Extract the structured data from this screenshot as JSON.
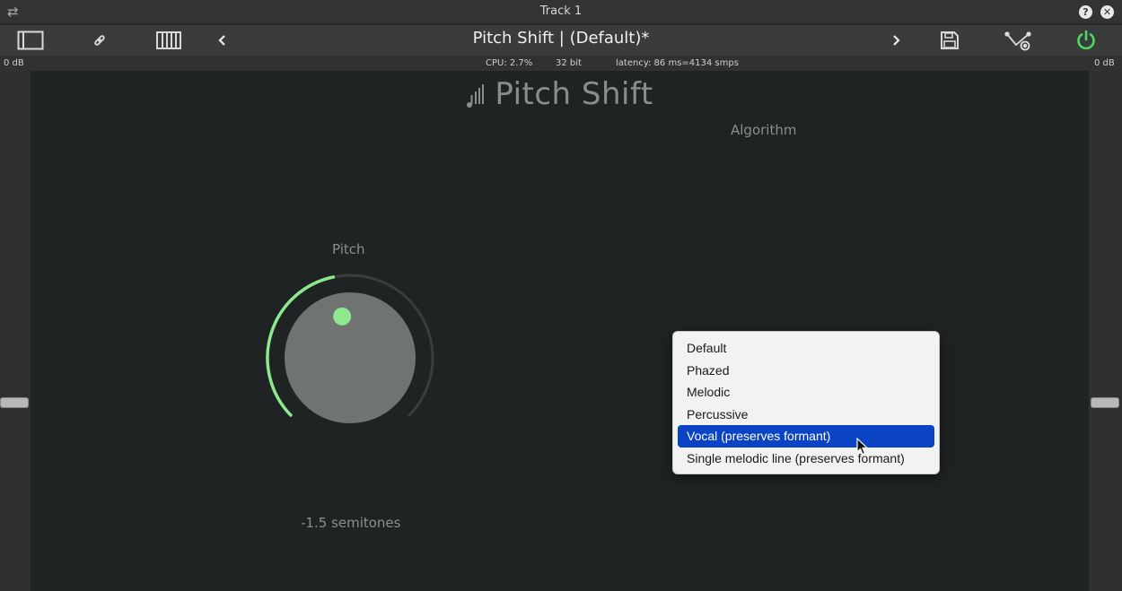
{
  "window": {
    "title": "Track 1"
  },
  "toolbar": {
    "preset_title": "Pitch Shift | (Default)*"
  },
  "status": {
    "left_gain": "0 dB",
    "cpu": "CPU: 2.7%",
    "bits": "32 bit",
    "latency": "latency: 86 ms=4134 smps",
    "right_gain": "0 dB"
  },
  "plugin": {
    "title": "Pitch Shift",
    "algorithm_label": "Algorithm",
    "pitch_label": "Pitch",
    "pitch_value": "-1.5 semitones",
    "knob_fraction": 0.46
  },
  "menu": {
    "items": [
      {
        "label": "Default"
      },
      {
        "label": "Phazed"
      },
      {
        "label": "Melodic"
      },
      {
        "label": "Percussive"
      },
      {
        "label": "Vocal (preserves formant)"
      },
      {
        "label": "Single melodic line (preserves formant)"
      }
    ],
    "selected_index": 4
  },
  "colors": {
    "accent_green": "#8ee88e",
    "selection_blue": "#0a44c4",
    "power_green": "#4cd964"
  }
}
